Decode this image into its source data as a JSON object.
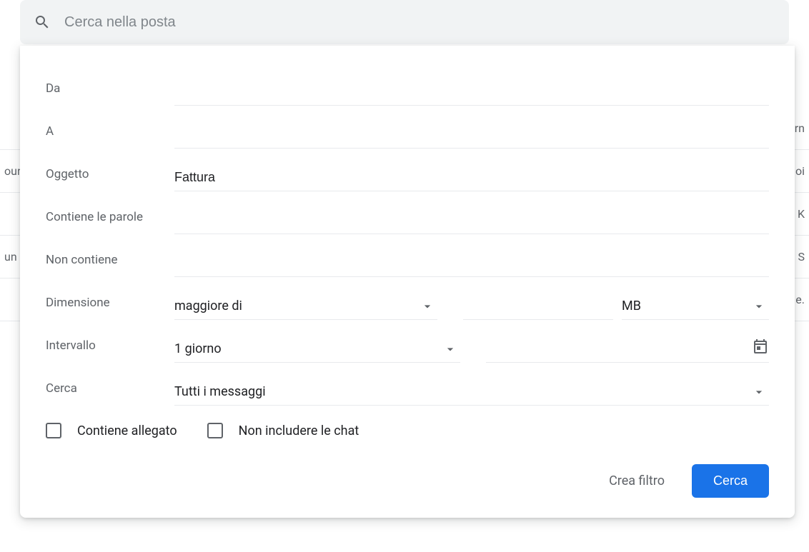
{
  "search": {
    "placeholder": "Cerca nella posta",
    "value": ""
  },
  "bg": {
    "row1_left": "",
    "row1_right": "orn",
    "row2_left": "our",
    "row2_right": "loi",
    "row3_left": "",
    "row3_right": "r K",
    "row4_left": "un",
    "row4_right": "s S",
    "row5_left": "",
    "row5_right": "e."
  },
  "fields": {
    "from": {
      "label": "Da",
      "value": ""
    },
    "to": {
      "label": "A",
      "value": ""
    },
    "subject": {
      "label": "Oggetto",
      "value": "Fattura"
    },
    "has_words": {
      "label": "Contiene le parole",
      "value": ""
    },
    "not_has": {
      "label": "Non contiene",
      "value": ""
    },
    "size": {
      "label": "Dimensione",
      "operator": "maggiore di",
      "value": "",
      "unit": "MB"
    },
    "interval": {
      "label": "Intervallo",
      "value": "1 giorno",
      "date": ""
    },
    "search_in": {
      "label": "Cerca",
      "value": "Tutti i messaggi"
    }
  },
  "checkboxes": {
    "has_attachment": "Contiene allegato",
    "exclude_chats": "Non includere le chat"
  },
  "buttons": {
    "create_filter": "Crea filtro",
    "search": "Cerca"
  }
}
